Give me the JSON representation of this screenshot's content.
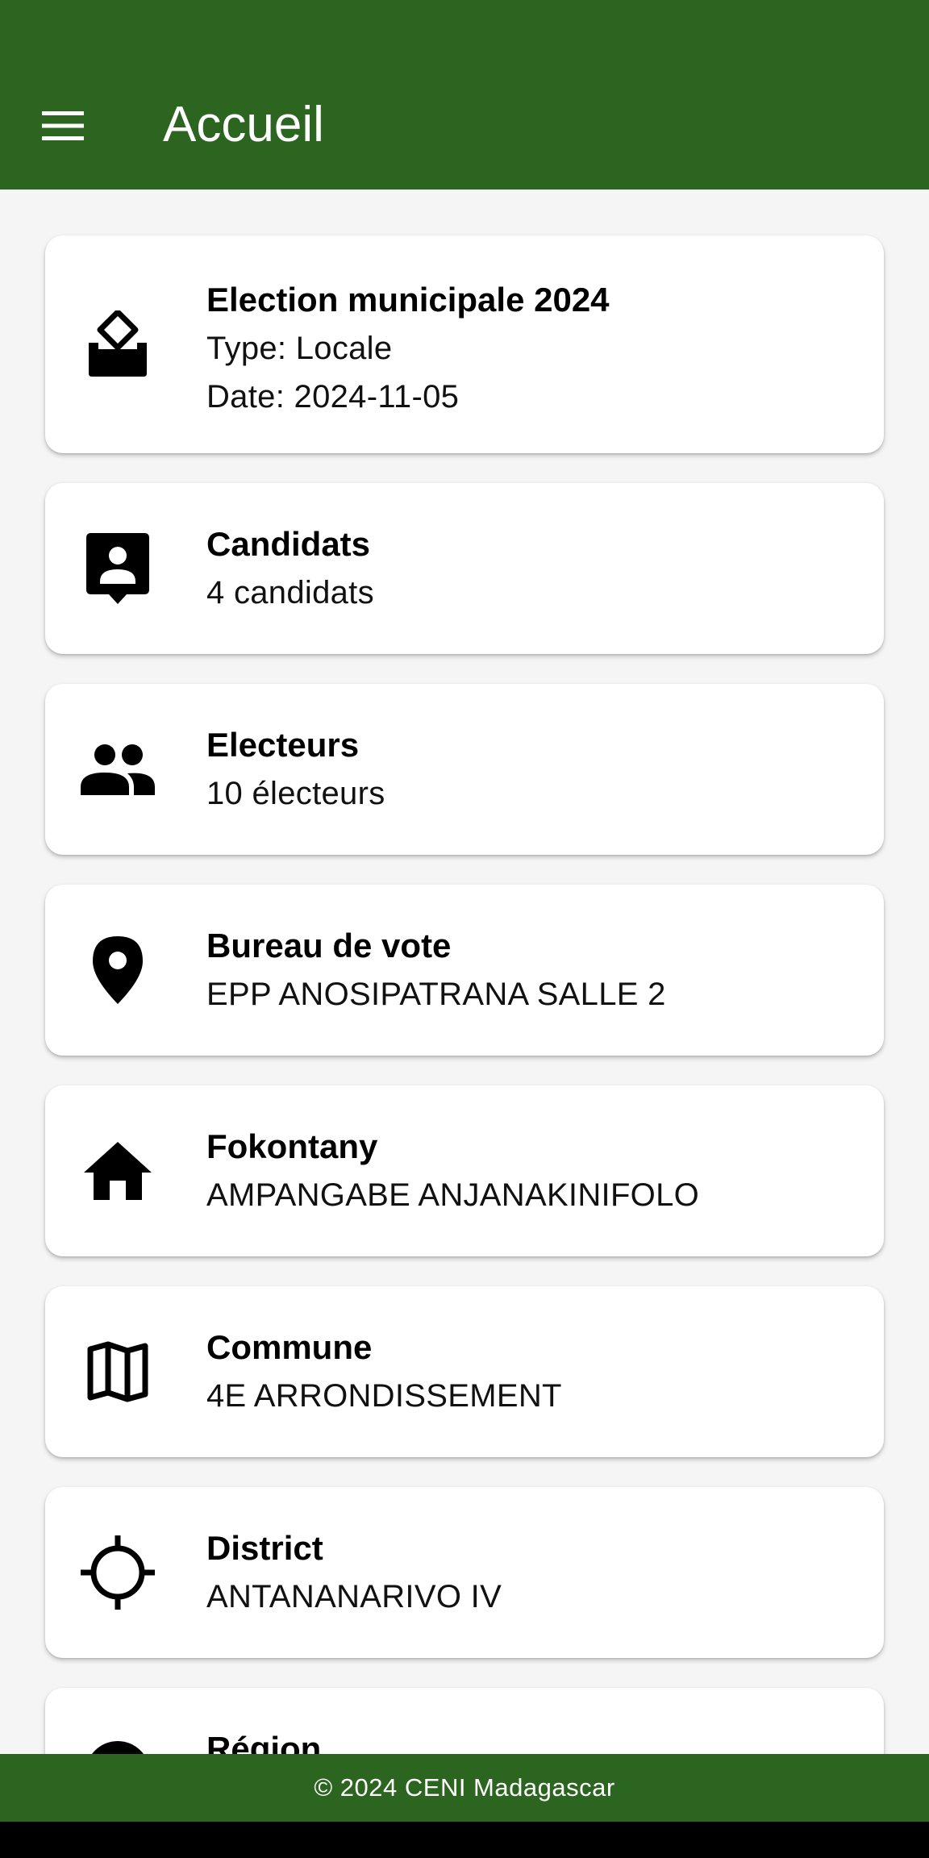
{
  "appbar": {
    "title": "Accueil",
    "menu_icon": "menu-icon",
    "color": "#2c6520"
  },
  "cards": {
    "election": {
      "icon": "ballot-box-icon",
      "title": "Election municipale 2024",
      "type": "Type: Locale",
      "date": "Date: 2024-11-05"
    },
    "candidats": {
      "icon": "contact-badge-icon",
      "title": "Candidats",
      "value": "4 candidats"
    },
    "electeurs": {
      "icon": "people-icon",
      "title": "Electeurs",
      "value": "10 électeurs"
    },
    "bureau": {
      "icon": "location-pin-icon",
      "title": "Bureau de vote",
      "value": "EPP ANOSIPATRANA SALLE 2"
    },
    "fokontany": {
      "icon": "home-icon",
      "title": "Fokontany",
      "value": "AMPANGABE ANJANAKINIFOLO"
    },
    "commune": {
      "icon": "map-icon",
      "title": "Commune",
      "value": "4E ARRONDISSEMENT"
    },
    "district": {
      "icon": "crosshair-icon",
      "title": "District",
      "value": "ANTANANARIVO IV"
    },
    "region": {
      "icon": "pie-chart-icon",
      "title": "Région"
    }
  },
  "footer": {
    "text": "© 2024 CENI Madagascar"
  }
}
